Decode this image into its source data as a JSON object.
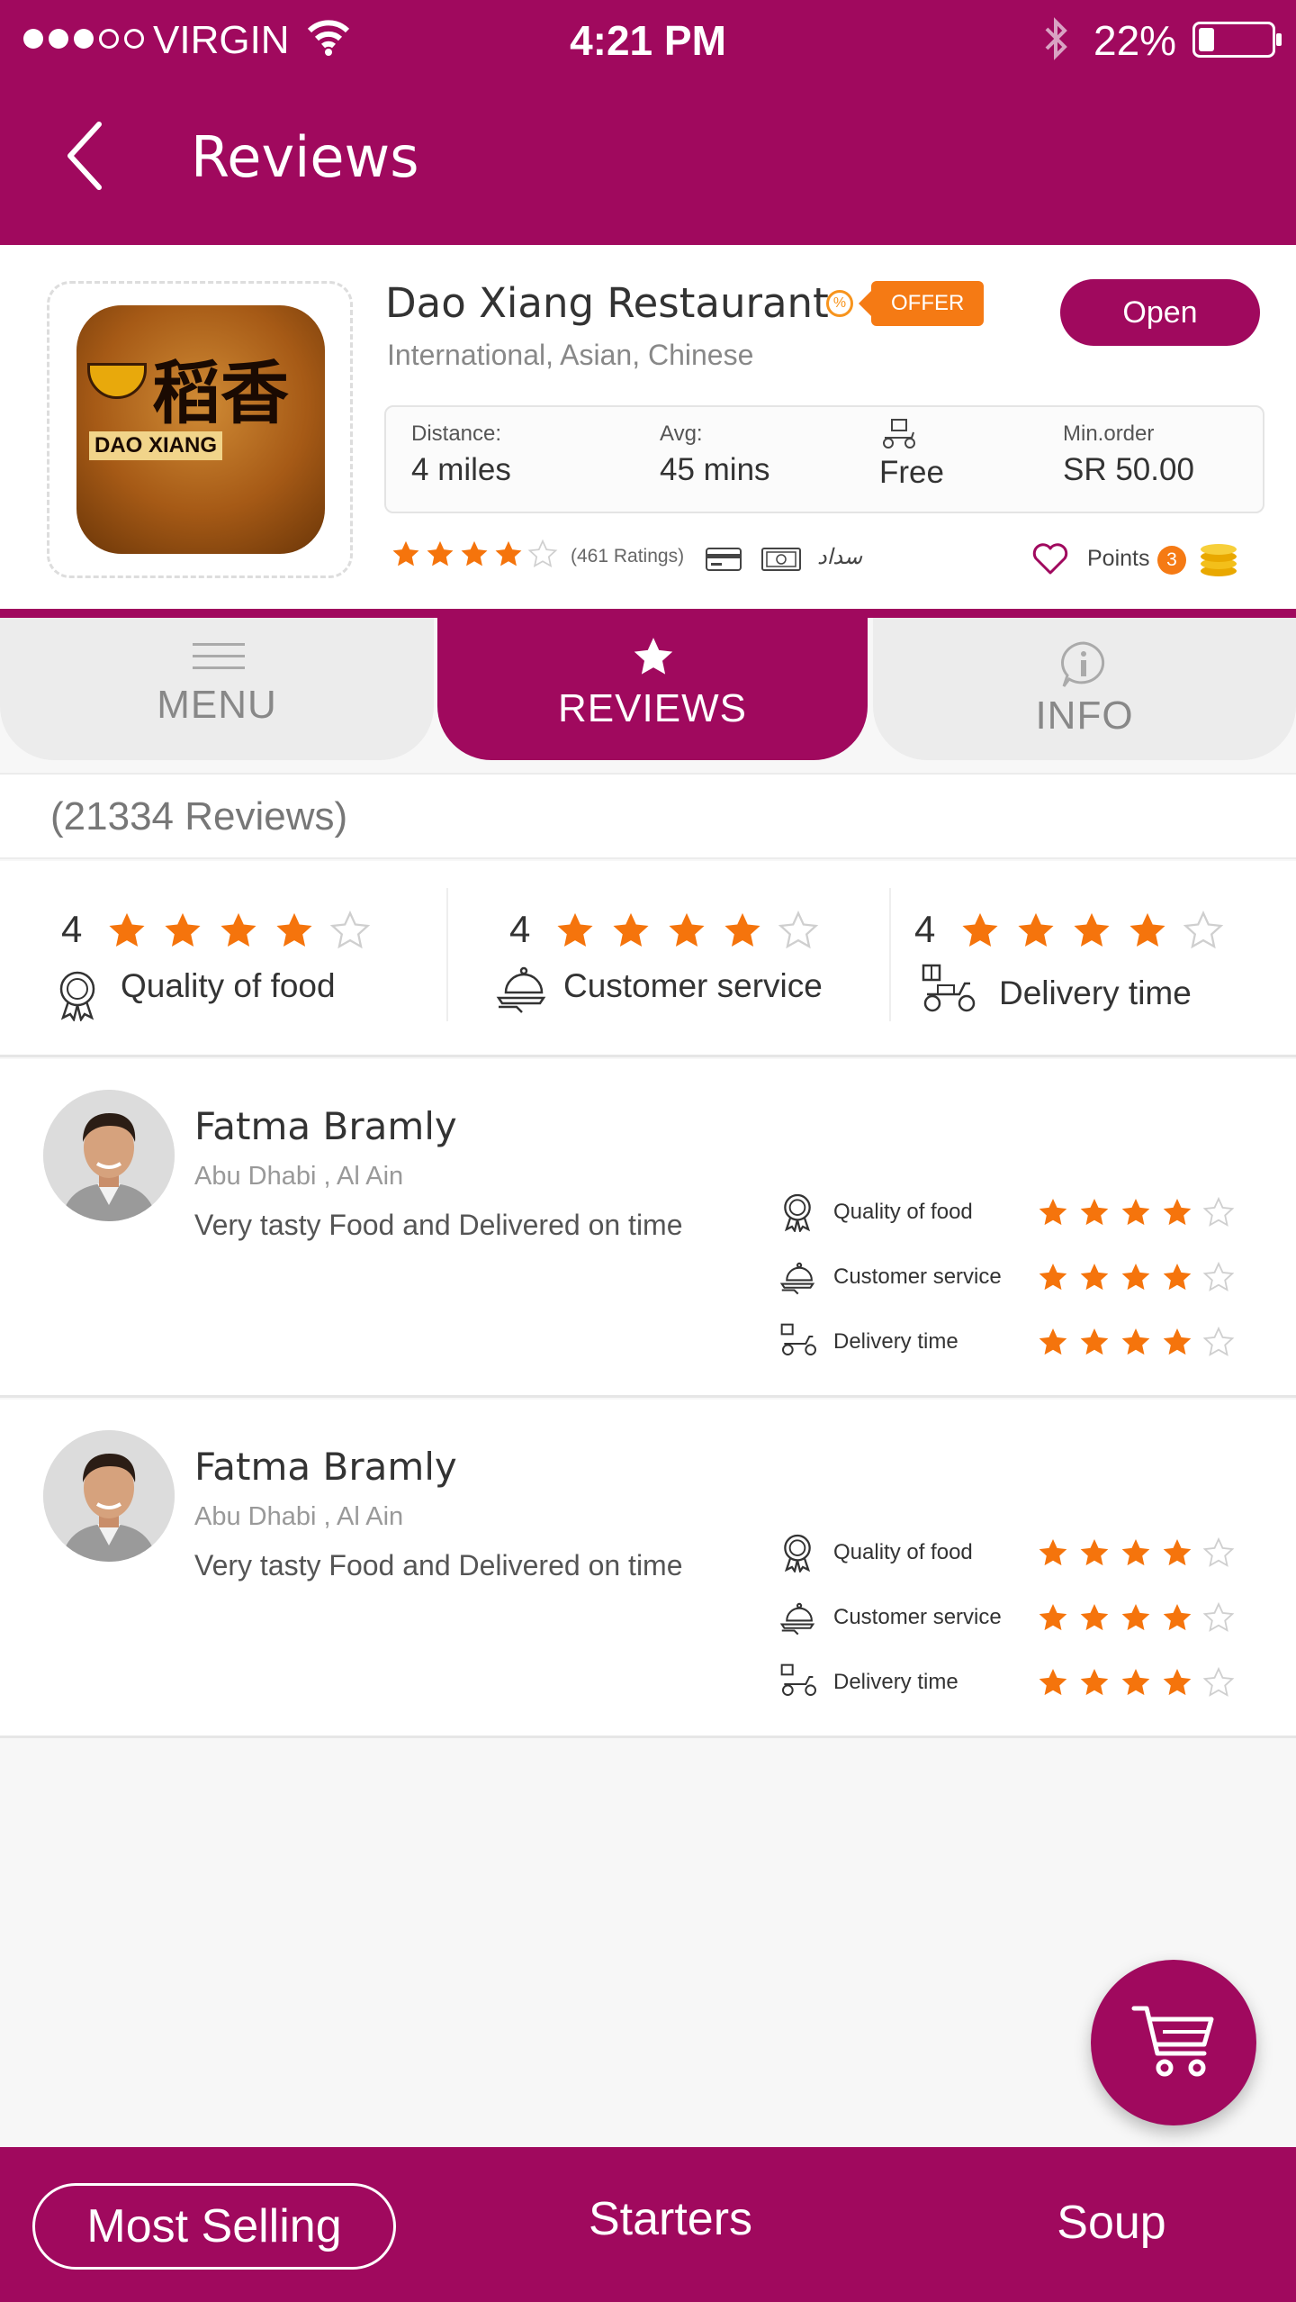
{
  "status_bar": {
    "carrier": "VIRGIN",
    "time": "4:21 PM",
    "battery": "22%",
    "battery_level": 0.22
  },
  "header": {
    "title": "Reviews"
  },
  "restaurant": {
    "name": "Dao Xiang Restaurant",
    "offer_label": "OFFER",
    "status_label": "Open",
    "cuisine": "International, Asian, Chinese",
    "logo_text_chinese": "稻香",
    "logo_text_brand": "DAO XIANG",
    "info": {
      "distance_label": "Distance:",
      "distance_value": "4 miles",
      "avg_label": "Avg:",
      "avg_value": "45 mins",
      "delivery_value": "Free",
      "min_order_label": "Min.order",
      "min_order_value": "SR 50.00"
    },
    "rating": 4,
    "ratings_count": "(461 Ratings)",
    "payment_icons": [
      "card-icon",
      "cash-icon",
      "sadad-icon"
    ],
    "sadad_text": "سداد",
    "points_label": "Points",
    "points_count": "3"
  },
  "tabs": [
    {
      "label": "MENU",
      "icon": "menu-icon",
      "active": false
    },
    {
      "label": "REVIEWS",
      "icon": "star-icon",
      "active": true
    },
    {
      "label": "INFO",
      "icon": "info-icon",
      "active": false
    }
  ],
  "reviews_summary": {
    "total": "(21334 Reviews)",
    "categories": [
      {
        "score": "4",
        "rating": 4,
        "label": "Quality of food",
        "icon": "award-icon"
      },
      {
        "score": "4",
        "rating": 4,
        "label": "Customer service",
        "icon": "cloche-icon"
      },
      {
        "score": "4",
        "rating": 4,
        "label": "Delivery time",
        "icon": "scooter-icon"
      }
    ]
  },
  "reviews": [
    {
      "name": "Fatma Bramly",
      "location": "Abu Dhabi , Al Ain",
      "comment": "Very tasty Food and Delivered on time",
      "criteria": [
        {
          "label": "Quality of food",
          "rating": 4
        },
        {
          "label": "Customer service",
          "rating": 4
        },
        {
          "label": "Delivery time",
          "rating": 4
        }
      ]
    },
    {
      "name": "Fatma Bramly",
      "location": "Abu Dhabi , Al Ain",
      "comment": "Very tasty Food and Delivered on time",
      "criteria": [
        {
          "label": "Quality of food",
          "rating": 4
        },
        {
          "label": "Customer service",
          "rating": 4
        },
        {
          "label": "Delivery time",
          "rating": 4
        }
      ]
    }
  ],
  "bottom_nav": [
    {
      "label": "Most Selling",
      "selected": true
    },
    {
      "label": "Starters",
      "selected": false
    },
    {
      "label": "Soup",
      "selected": false
    }
  ],
  "colors": {
    "primary": "#a0095e",
    "accent": "#f57a14",
    "star": "#f5740c"
  }
}
